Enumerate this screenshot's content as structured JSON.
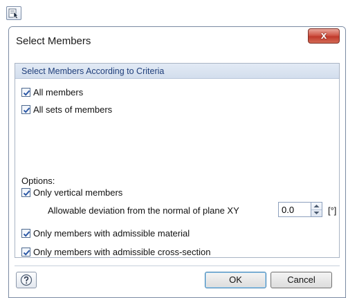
{
  "window": {
    "title": "Select Members",
    "close_label": "x"
  },
  "group": {
    "header": "Select Members According to Criteria"
  },
  "checks": {
    "all_members": {
      "label": "All members",
      "checked": true
    },
    "all_sets": {
      "label": "All sets of members",
      "checked": true
    },
    "vertical": {
      "label": "Only vertical members",
      "checked": true
    },
    "material": {
      "label": "Only members with admissible material",
      "checked": true
    },
    "cross_section": {
      "label": "Only members with admissible cross-section",
      "checked": true
    }
  },
  "options": {
    "label": "Options:"
  },
  "deviation": {
    "label": "Allowable deviation from the normal of plane XY",
    "value": "0.0",
    "unit": "[°]"
  },
  "buttons": {
    "ok": "OK",
    "cancel": "Cancel"
  },
  "icons": {
    "toolbar": "select-members-icon",
    "help": "help-icon",
    "check": "checkmark-icon"
  },
  "colors": {
    "header_text": "#1f3e7a",
    "header_bg": "#dbe4f1",
    "close_red": "#c0392b",
    "check_blue": "#2d59a6"
  }
}
